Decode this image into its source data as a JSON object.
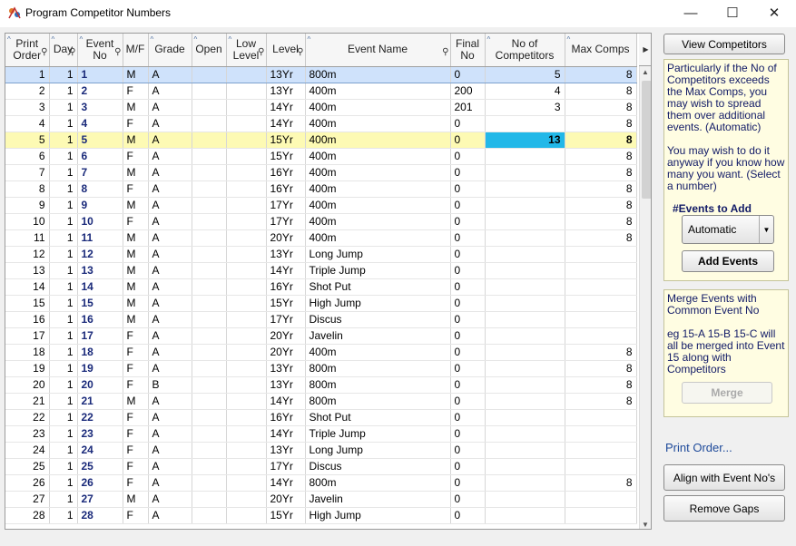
{
  "window": {
    "title": "Program Competitor Numbers",
    "minimize": "—",
    "maximize": "☐",
    "close": "✕"
  },
  "columns": [
    "Print Order",
    "Day",
    "Event No",
    "M/F",
    "Grade",
    "Open",
    "Low Level",
    "Level",
    "Event Name",
    "Final No",
    "No of Competitors",
    "Max Comps"
  ],
  "rows": [
    [
      "1",
      "1",
      "1",
      "M",
      "A",
      "",
      "",
      "13Yr",
      "800m",
      "0",
      "5",
      "8"
    ],
    [
      "2",
      "1",
      "2",
      "F",
      "A",
      "",
      "",
      "13Yr",
      "400m",
      "200",
      "4",
      "8"
    ],
    [
      "3",
      "1",
      "3",
      "M",
      "A",
      "",
      "",
      "14Yr",
      "400m",
      "201",
      "3",
      "8"
    ],
    [
      "4",
      "1",
      "4",
      "F",
      "A",
      "",
      "",
      "14Yr",
      "400m",
      "0",
      "",
      "8"
    ],
    [
      "5",
      "1",
      "5",
      "M",
      "A",
      "",
      "",
      "15Yr",
      "400m",
      "0",
      "13",
      "8"
    ],
    [
      "6",
      "1",
      "6",
      "F",
      "A",
      "",
      "",
      "15Yr",
      "400m",
      "0",
      "",
      "8"
    ],
    [
      "7",
      "1",
      "7",
      "M",
      "A",
      "",
      "",
      "16Yr",
      "400m",
      "0",
      "",
      "8"
    ],
    [
      "8",
      "1",
      "8",
      "F",
      "A",
      "",
      "",
      "16Yr",
      "400m",
      "0",
      "",
      "8"
    ],
    [
      "9",
      "1",
      "9",
      "M",
      "A",
      "",
      "",
      "17Yr",
      "400m",
      "0",
      "",
      "8"
    ],
    [
      "10",
      "1",
      "10",
      "F",
      "A",
      "",
      "",
      "17Yr",
      "400m",
      "0",
      "",
      "8"
    ],
    [
      "11",
      "1",
      "11",
      "M",
      "A",
      "",
      "",
      "20Yr",
      "400m",
      "0",
      "",
      "8"
    ],
    [
      "12",
      "1",
      "12",
      "M",
      "A",
      "",
      "",
      "13Yr",
      "Long Jump",
      "0",
      "",
      ""
    ],
    [
      "13",
      "1",
      "13",
      "M",
      "A",
      "",
      "",
      "14Yr",
      "Triple Jump",
      "0",
      "",
      ""
    ],
    [
      "14",
      "1",
      "14",
      "M",
      "A",
      "",
      "",
      "16Yr",
      "Shot Put",
      "0",
      "",
      ""
    ],
    [
      "15",
      "1",
      "15",
      "M",
      "A",
      "",
      "",
      "15Yr",
      "High Jump",
      "0",
      "",
      ""
    ],
    [
      "16",
      "1",
      "16",
      "M",
      "A",
      "",
      "",
      "17Yr",
      "Discus",
      "0",
      "",
      ""
    ],
    [
      "17",
      "1",
      "17",
      "F",
      "A",
      "",
      "",
      "20Yr",
      "Javelin",
      "0",
      "",
      ""
    ],
    [
      "18",
      "1",
      "18",
      "F",
      "A",
      "",
      "",
      "20Yr",
      "400m",
      "0",
      "",
      "8"
    ],
    [
      "19",
      "1",
      "19",
      "F",
      "A",
      "",
      "",
      "13Yr",
      "800m",
      "0",
      "",
      "8"
    ],
    [
      "20",
      "1",
      "20",
      "F",
      "B",
      "",
      "",
      "13Yr",
      "800m",
      "0",
      "",
      "8"
    ],
    [
      "21",
      "1",
      "21",
      "M",
      "A",
      "",
      "",
      "14Yr",
      "800m",
      "0",
      "",
      "8"
    ],
    [
      "22",
      "1",
      "22",
      "F",
      "A",
      "",
      "",
      "16Yr",
      "Shot Put",
      "0",
      "",
      ""
    ],
    [
      "23",
      "1",
      "23",
      "F",
      "A",
      "",
      "",
      "14Yr",
      "Triple Jump",
      "0",
      "",
      ""
    ],
    [
      "24",
      "1",
      "24",
      "F",
      "A",
      "",
      "",
      "13Yr",
      "Long Jump",
      "0",
      "",
      ""
    ],
    [
      "25",
      "1",
      "25",
      "F",
      "A",
      "",
      "",
      "17Yr",
      "Discus",
      "0",
      "",
      ""
    ],
    [
      "26",
      "1",
      "26",
      "F",
      "A",
      "",
      "",
      "14Yr",
      "800m",
      "0",
      "",
      "8"
    ],
    [
      "27",
      "1",
      "27",
      "M",
      "A",
      "",
      "",
      "20Yr",
      "Javelin",
      "0",
      "",
      ""
    ],
    [
      "28",
      "1",
      "28",
      "F",
      "A",
      "",
      "",
      "15Yr",
      "High Jump",
      "0",
      "",
      ""
    ]
  ],
  "selected_row": 0,
  "highlight_row": 4,
  "sidebar": {
    "view_competitors": "View Competitors",
    "info_text_1": "Particularly if the No of Competitors exceeds the Max Comps, you may wish to spread them over additional events. (Automatic)",
    "info_text_2": "You may wish to do it anyway if you know how many you want. (Select a number)",
    "events_to_add_label": "#Events to Add",
    "events_to_add_value": "Automatic",
    "add_events": "Add Events",
    "merge_text_1": "Merge Events with Common Event No",
    "merge_text_2": "eg 15-A  15-B  15-C will all be merged into Event 15 along with Competitors",
    "merge": "Merge",
    "print_order_label": "Print Order...",
    "align": "Align with Event No's",
    "remove_gaps": "Remove Gaps"
  },
  "colors": {
    "selected_row": "#cfe2fb",
    "highlight_row": "#fdfab4",
    "active_cell": "#22b8e8",
    "panel_bg": "#fffde2",
    "panel_text": "#111a66"
  }
}
